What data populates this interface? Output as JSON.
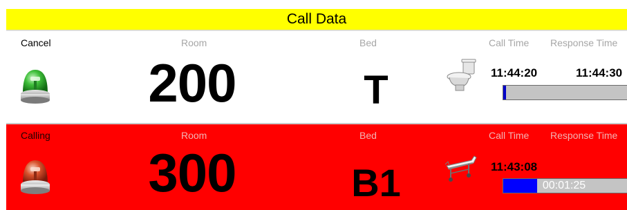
{
  "header": {
    "title": "Call Data"
  },
  "labels": {
    "room": "Room",
    "bed": "Bed",
    "call_time": "Call Time",
    "response_time": "Response Time"
  },
  "calls": [
    {
      "status": "Cancel",
      "room": "200",
      "bed": "T",
      "device_icon": "toilet-icon",
      "beacon_color": "#22a92b",
      "call_time": "11:44:20",
      "response_time": "11:44:30",
      "progress_text": "",
      "progress_fraction": 0.02,
      "progress_color": "#0000c8"
    },
    {
      "status": "Calling",
      "room": "300",
      "bed": "B1",
      "device_icon": "hospital-bed-icon",
      "beacon_color": "#c0391f",
      "call_time": "11:43:08",
      "response_time": "",
      "progress_text": "00:01:25",
      "progress_fraction": 0.27,
      "progress_color": "#0000ff"
    }
  ],
  "colors": {
    "header_bg": "#ffff00",
    "calling_row_bg": "#ff0000",
    "cancel_row_bg": "#ffffff"
  }
}
